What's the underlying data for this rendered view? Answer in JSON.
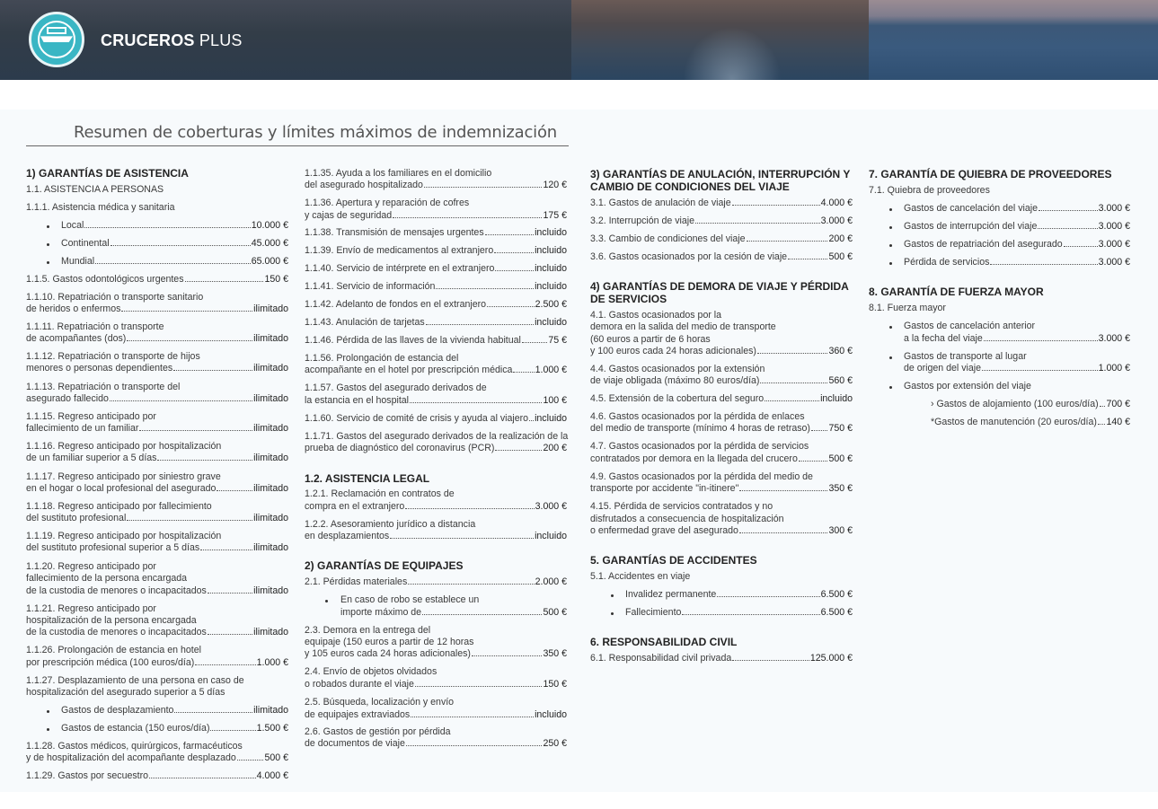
{
  "brand": {
    "bold": "CRUCEROS",
    "light": "PLUS"
  },
  "title": "Resumen de coberturas y límites máximos de indemnización",
  "c1": {
    "h1": "1) GARANTÍAS DE ASISTENCIA",
    "s1": "1.1. ASISTENCIA A PERSONAS",
    "s2": "1.1.1. Asistencia médica y sanitaria",
    "b_local": "Local",
    "b_local_v": "10.000 €",
    "b_cont": "Continental",
    "b_cont_v": "45.000 €",
    "b_mund": "Mundial",
    "b_mund_v": "65.000 €",
    "i115": "1.1.5. Gastos odontológicos urgentes",
    "i115v": "150 €",
    "i1110a": "1.1.10. Repatriación o transporte sanitario",
    "i1110b": "de heridos o enfermos",
    "i1110v": "ilimitado",
    "i1111a": "1.1.11. Repatriación o transporte",
    "i1111b": "de acompañantes (dos)",
    "i1111v": "ilimitado",
    "i1112a": "1.1.12. Repatriación o transporte de hijos",
    "i1112b": "menores o personas dependientes",
    "i1112v": "ilimitado",
    "i1113a": "1.1.13. Repatriación o transporte del",
    "i1113b": "asegurado fallecido",
    "i1113v": "ilimitado",
    "i1115a": "1.1.15. Regreso anticipado por",
    "i1115b": "fallecimiento de un familiar",
    "i1115v": "ilimitado",
    "i1116a": "1.1.16. Regreso anticipado por hospitalización",
    "i1116b": "de un familiar superior a 5 días",
    "i1116v": "ilimitado",
    "i1117a": "1.1.17. Regreso anticipado por siniestro grave",
    "i1117b": "en el hogar o local profesional del asegurado",
    "i1117v": "ilimitado",
    "i1118a": "1.1.18. Regreso anticipado por fallecimiento",
    "i1118b": "del sustituto profesional",
    "i1118v": "ilimitado",
    "i1119a": "1.1.19. Regreso anticipado por hospitalización",
    "i1119b": "del sustituto profesional superior a 5 días",
    "i1119v": "ilimitado",
    "i1120a": "1.1.20. Regreso anticipado por",
    "i1120b": "fallecimiento de la persona encargada",
    "i1120c": "de la custodia de menores o incapacitados",
    "i1120v": "ilimitado",
    "i1121a": "1.1.21. Regreso anticipado por",
    "i1121b": "hospitalización de la persona encargada",
    "i1121c": "de la custodia de menores o incapacitados",
    "i1121v": "ilimitado",
    "i1126a": "1.1.26. Prolongación de estancia en hotel",
    "i1126b": "por prescripción médica (100 euros/día)",
    "i1126v": "1.000 €",
    "i1127a": "1.1.27. Desplazamiento de una persona en caso de",
    "i1127b": "hospitalización del asegurado superior a 5 días",
    "b_desp": "Gastos de desplazamiento",
    "b_desp_v": "ilimitado",
    "b_est": "Gastos de estancia (150 euros/día)",
    "b_est_v": "1.500 €",
    "i1128a": "1.1.28. Gastos médicos, quirúrgicos, farmacéuticos",
    "i1128b": "y de hospitalización del acompañante desplazado",
    "i1128v": "500 €",
    "i1129": "1.1.29. Gastos por secuestro",
    "i1129v": "4.000 €"
  },
  "c2": {
    "i135a": "1.1.35. Ayuda a los familiares en el domicilio",
    "i135b": "del asegurado hospitalizado",
    "i135v": "120 €",
    "i136a": "1.1.36. Apertura y reparación de cofres",
    "i136b": "y cajas de seguridad",
    "i136v": "175 €",
    "i138": "1.1.38. Transmisión de mensajes urgentes",
    "i138v": "incluido",
    "i139": "1.1.39. Envío de medicamentos al extranjero",
    "i139v": "incluido",
    "i140": "1.1.40. Servicio de intérprete en el extranjero",
    "i140v": "incluido",
    "i141": "1.1.41. Servicio de información",
    "i141v": "incluido",
    "i142": "1.1.42. Adelanto de fondos en el extranjero",
    "i142v": "2.500 €",
    "i143": "1.1.43. Anulación de tarjetas",
    "i143v": "incluido",
    "i146": "1.1.46. Pérdida de las llaves de la vivienda habitual",
    "i146v": "75 €",
    "i156a": "1.1.56. Prolongación de estancia del",
    "i156b": "acompañante en el hotel por prescripción médica",
    "i156v": "1.000 €",
    "i157a": "1.1.57. Gastos del asegurado derivados de",
    "i157b": "la estancia en el hospital",
    "i157v": "100 €",
    "i160": "1.1.60. Servicio de comité de crisis y ayuda al viajero",
    "i160v": "incluido",
    "i171a": "1.1.71. Gastos del asegurado derivados de la realización de la",
    "i171b": "prueba de diagnóstico del coronavirus (PCR)",
    "i171v": "200 €",
    "h12": "1.2. ASISTENCIA LEGAL",
    "i121a": "1.2.1. Reclamación en contratos de",
    "i121b": "compra en el extranjero",
    "i121v": "3.000 €",
    "i122a": "1.2.2. Asesoramiento jurídico a distancia",
    "i122b": "en desplazamientos",
    "i122v": "incluido",
    "h2": "2) GARANTÍAS DE EQUIPAJES",
    "i21": "2.1. Pérdidas materiales",
    "i21v": "2.000 €",
    "b_robo_a": "En caso de robo se establece un",
    "b_robo_b": "importe máximo de",
    "b_robo_v": "500 €",
    "i23a": "2.3. Demora en la entrega del",
    "i23b": "equipaje (150 euros a partir de 12 horas",
    "i23c": "y 105 euros cada 24 horas adicionales)",
    "i23v": "350 €",
    "i24a": "2.4. Envío de objetos olvidados",
    "i24b": "o robados durante el viaje",
    "i24v": "150 €",
    "i25a": "2.5. Búsqueda, localización y envío",
    "i25b": "de equipajes extraviados",
    "i25v": "incluido",
    "i26a": "2.6. Gastos de gestión por pérdida",
    "i26b": "de documentos de viaje",
    "i26v": "250 €"
  },
  "c3": {
    "h3a": "3) GARANTÍAS DE ANULACIÓN, INTERRUPCIÓN Y",
    "h3b": "CAMBIO DE CONDICIONES DEL VIAJE",
    "i31": "3.1. Gastos de anulación de viaje",
    "i31v": "4.000 €",
    "i32": "3.2. Interrupción de viaje",
    "i32v": "3.000 €",
    "i33": "3.3. Cambio de condiciones del viaje",
    "i33v": "200 €",
    "i36": "3.6. Gastos ocasionados por la cesión de viaje",
    "i36v": "500 €",
    "h4a": "4) GARANTÍAS DE DEMORA DE VIAJE Y PÉRDIDA",
    "h4b": "DE SERVICIOS",
    "i41a": "4.1. Gastos ocasionados por la",
    "i41b": "demora en la salida del medio de transporte",
    "i41c": "(60 euros a partir de 6 horas",
    "i41d": "y 100 euros cada 24 horas adicionales)",
    "i41v": "360 €",
    "i44a": "4.4. Gastos ocasionados por la extensión",
    "i44b": "de viaje obligada (máximo 80 euros/día)",
    "i44v": "560 €",
    "i45": "4.5. Extensión de la cobertura del seguro",
    "i45v": "incluido",
    "i46a": "4.6. Gastos ocasionados por la pérdida de enlaces",
    "i46b": "del medio de transporte (mínimo 4 horas de retraso)",
    "i46v": "750 €",
    "i47a": "4.7. Gastos ocasionados por la pérdida de servicios",
    "i47b": "contratados por demora en la llegada del crucero",
    "i47v": "500 €",
    "i49a": "4.9. Gastos ocasionados por la pérdida del medio de",
    "i49b": "transporte por accidente \"in-itinere\"",
    "i49v": "350 €",
    "i415a": "4.15. Pérdida de servicios contratados y no",
    "i415b": "disfrutados a consecuencia de hospitalización",
    "i415c": "o enfermedad grave del asegurado",
    "i415v": "300 €",
    "h5": "5. GARANTÍAS DE ACCIDENTES",
    "i51": "5.1. Accidentes en viaje",
    "b_inv": "Invalidez permanente",
    "b_inv_v": "6.500 €",
    "b_fal": "Fallecimiento",
    "b_fal_v": "6.500 €",
    "h6": "6. RESPONSABILIDAD CIVIL",
    "i61": "6.1. Responsabilidad civil privada",
    "i61v": "125.000 €"
  },
  "c4": {
    "h7": "7. GARANTÍA DE QUIEBRA DE PROVEEDORES",
    "i71": "7.1. Quiebra de proveedores",
    "b_canc": "Gastos de cancelación del viaje",
    "b_canc_v": "3.000 €",
    "b_int": "Gastos de interrupción del viaje",
    "b_int_v": "3.000 €",
    "b_rep": "Gastos de repatriación del asegurado",
    "b_rep_v": "3.000 €",
    "b_per": "Pérdida de servicios",
    "b_per_v": "3.000 €",
    "h8": "8. GARANTÍA DE FUERZA MAYOR",
    "i81": "8.1. Fuerza mayor",
    "b_ca_a": "Gastos de cancelación anterior",
    "b_ca_b": "a la fecha del viaje",
    "b_ca_v": "3.000 €",
    "b_tr_a": "Gastos de transporte al lugar",
    "b_tr_b": "de origen del viaje",
    "b_tr_v": "1.000 €",
    "b_ext": "Gastos por extensión del viaje",
    "s_alo": "› Gastos de alojamiento (100 euros/día)",
    "s_alo_v": "700 €",
    "s_man": "*Gastos de manutención (20 euros/día)",
    "s_man_v": "140 €"
  }
}
